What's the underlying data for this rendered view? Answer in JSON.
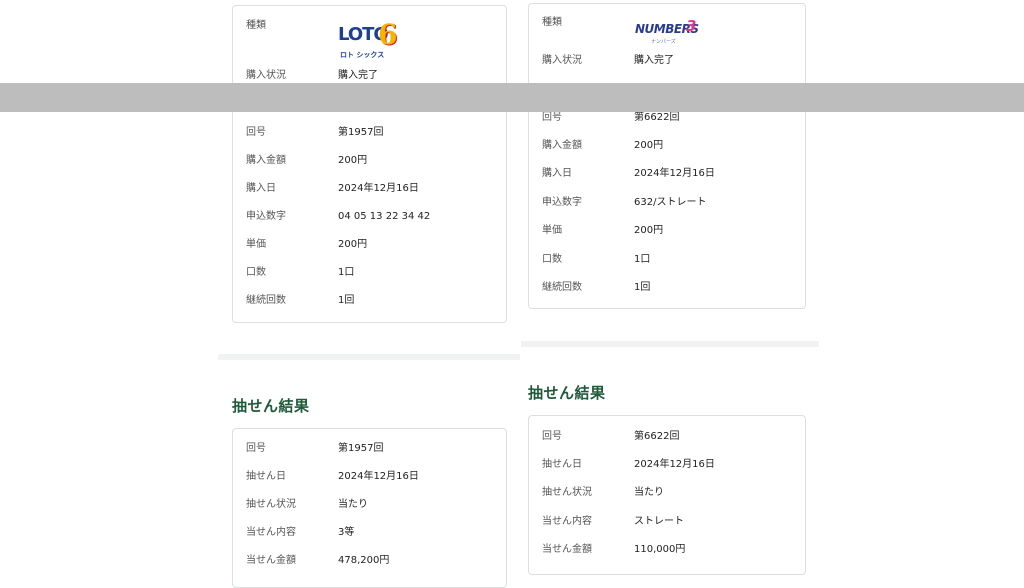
{
  "loto6": {
    "logo": {
      "main": "LOTO",
      "number": "6",
      "sub": "ロト シックス"
    },
    "purchase": [
      {
        "label": "種類",
        "value": ""
      },
      {
        "label": "購入状況",
        "value": "購入完了"
      },
      {
        "label": "回号",
        "value": "第1957回"
      },
      {
        "label": "購入金額",
        "value": "200円"
      },
      {
        "label": "購入日",
        "value": "2024年12月16日"
      },
      {
        "label": "申込数字",
        "value": "04 05 13 22 34 42"
      },
      {
        "label": "単価",
        "value": "200円"
      },
      {
        "label": "口数",
        "value": "1口"
      },
      {
        "label": "継続回数",
        "value": "1回"
      }
    ],
    "result_heading": "抽せん結果",
    "result": [
      {
        "label": "回号",
        "value": "第1957回"
      },
      {
        "label": "抽せん日",
        "value": "2024年12月16日"
      },
      {
        "label": "抽せん状況",
        "value": "当たり"
      },
      {
        "label": "当せん内容",
        "value": "3等"
      },
      {
        "label": "当せん金額",
        "value": "478,200円"
      }
    ]
  },
  "numbers3": {
    "logo": {
      "main": "NUMBERS",
      "number": "3",
      "sub": "ナンバーズ"
    },
    "purchase": [
      {
        "label": "種類",
        "value": ""
      },
      {
        "label": "購入状況",
        "value": "購入完了"
      },
      {
        "label": "回号",
        "value": "第6622回"
      },
      {
        "label": "購入金額",
        "value": "200円"
      },
      {
        "label": "購入日",
        "value": "2024年12月16日"
      },
      {
        "label": "申込数字",
        "value": "632/ストレート"
      },
      {
        "label": "単価",
        "value": "200円"
      },
      {
        "label": "口数",
        "value": "1口"
      },
      {
        "label": "継続回数",
        "value": "1回"
      }
    ],
    "result_heading": "抽せん結果",
    "result": [
      {
        "label": "回号",
        "value": "第6622回"
      },
      {
        "label": "抽せん日",
        "value": "2024年12月16日"
      },
      {
        "label": "抽せん状況",
        "value": "当たり"
      },
      {
        "label": "当せん内容",
        "value": "ストレート"
      },
      {
        "label": "当せん金額",
        "value": "110,000円"
      }
    ]
  },
  "colors": {
    "heading": "#1e5b3b",
    "border": "#dcdfe2",
    "overlay_bar": "#bdbdbd",
    "separator": "#f1f3f3"
  }
}
